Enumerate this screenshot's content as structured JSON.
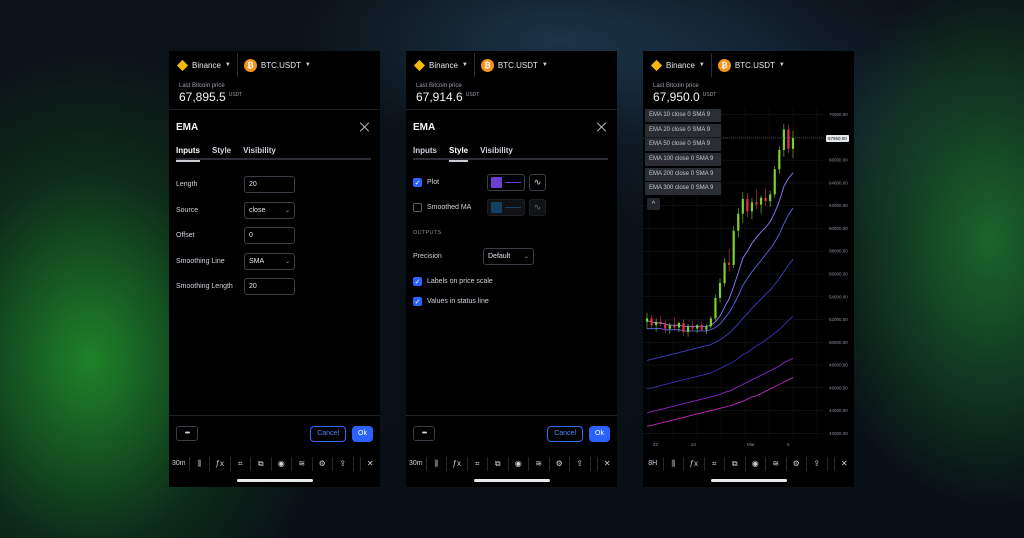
{
  "panels": [
    {
      "topbar": {
        "exchange": "Binance",
        "symbol": "BTC.USDT"
      },
      "price": {
        "label": "Last Bitcoin price",
        "value": "67,895.5",
        "unit": "USDT"
      },
      "dialog": {
        "title": "EMA",
        "tabs": [
          "Inputs",
          "Style",
          "Visibility"
        ],
        "active_tab": "Inputs",
        "inputs": [
          {
            "label": "Length",
            "value": "20"
          },
          {
            "label": "Source",
            "value": "close",
            "dropdown": true
          },
          {
            "label": "Offset",
            "value": "0"
          },
          {
            "label": "Smoothing Line",
            "value": "SMA",
            "dropdown": true
          },
          {
            "label": "Smoothing Length",
            "value": "20"
          }
        ],
        "more_label": "•••",
        "cancel_label": "Cancel",
        "ok_label": "Ok"
      },
      "toolbar": {
        "interval": "30m"
      }
    },
    {
      "topbar": {
        "exchange": "Binance",
        "symbol": "BTC.USDT"
      },
      "price": {
        "label": "Last Bitcoin price",
        "value": "67,914.6",
        "unit": "USDT"
      },
      "dialog": {
        "title": "EMA",
        "tabs": [
          "Inputs",
          "Style",
          "Visibility"
        ],
        "active_tab": "Style",
        "plot": {
          "label": "Plot",
          "checked": true,
          "color": "#6a3fd0"
        },
        "smoothed": {
          "label": "Smoothed MA",
          "checked": false,
          "color": "#2f7fc1"
        },
        "outputs_title": "OUTPUTS",
        "precision": {
          "label": "Precision",
          "value": "Default"
        },
        "labels_on_scale": {
          "label": "Labels on price scale",
          "checked": true
        },
        "values_in_status": {
          "label": "Values in status line",
          "checked": true
        },
        "more_label": "•••",
        "cancel_label": "Cancel",
        "ok_label": "Ok"
      },
      "toolbar": {
        "interval": "30m"
      }
    },
    {
      "topbar": {
        "exchange": "Binance",
        "symbol": "BTC.USDT"
      },
      "price": {
        "label": "Last Bitcoin price",
        "value": "67,950.0",
        "unit": "USDT"
      },
      "legend": [
        "EMA 10 close 0 SMA 9",
        "EMA 20 close 0 SMA 9",
        "EMA 50 close 0 SMA 9",
        "EMA 100 close 0 SMA 9",
        "EMA 200 close 0 SMA 9",
        "EMA 300 close 0 SMA 9"
      ],
      "collapse_icon": "^",
      "last_price_tag": "67950.00",
      "toolbar": {
        "interval": "8H"
      }
    }
  ],
  "toolbar_icons": [
    "candles-icon",
    "fx-icon",
    "crosshair-icon",
    "compare-icon",
    "eye-icon",
    "layers-icon",
    "gear-icon",
    "share-icon",
    "close-icon"
  ],
  "colors": {
    "accent": "#2962ff",
    "binance": "#f0b90b",
    "bitcoin": "#f7931a",
    "up": "#7bd12f",
    "down": "#e0324b"
  },
  "chart_data": {
    "type": "line",
    "title": "",
    "y_ticks": [
      "70000.00",
      "68000.00",
      "66000.00",
      "64000.00",
      "62000.00",
      "60000.00",
      "58000.00",
      "56000.00",
      "54000.00",
      "52000.00",
      "50000.00",
      "48000.00",
      "46000.00",
      "44000.00",
      "42000.00"
    ],
    "x_ticks": [
      "22",
      "24",
      "Mar",
      "5"
    ],
    "ylim": [
      41500,
      70500
    ],
    "candles": [
      [
        51800,
        52600,
        51200,
        52100
      ],
      [
        52100,
        52400,
        51300,
        51500
      ],
      [
        51500,
        52100,
        50900,
        51800
      ],
      [
        51800,
        52300,
        51400,
        51600
      ],
      [
        51600,
        51900,
        50800,
        51200
      ],
      [
        51200,
        51700,
        50700,
        51500
      ],
      [
        51500,
        52200,
        51100,
        51300
      ],
      [
        51300,
        51800,
        50900,
        51700
      ],
      [
        51700,
        52000,
        50600,
        50900
      ],
      [
        50900,
        51600,
        50500,
        51400
      ],
      [
        51400,
        51900,
        51000,
        51200
      ],
      [
        51200,
        51600,
        50800,
        51500
      ],
      [
        51500,
        51800,
        51000,
        51100
      ],
      [
        51100,
        51600,
        50700,
        51400
      ],
      [
        51400,
        52300,
        51200,
        52100
      ],
      [
        52100,
        54200,
        51900,
        53900
      ],
      [
        53900,
        55600,
        53500,
        55200
      ],
      [
        55200,
        57400,
        54900,
        57000
      ],
      [
        57000,
        58200,
        56200,
        56800
      ],
      [
        56800,
        60200,
        56500,
        59800
      ],
      [
        59800,
        61800,
        59200,
        61300
      ],
      [
        61300,
        63200,
        60500,
        62600
      ],
      [
        62600,
        63100,
        61000,
        61500
      ],
      [
        61500,
        62700,
        60800,
        62300
      ],
      [
        62300,
        63400,
        61700,
        62100
      ],
      [
        62100,
        62900,
        61300,
        62700
      ],
      [
        62700,
        63500,
        62000,
        62400
      ],
      [
        62400,
        63300,
        61900,
        63000
      ],
      [
        63000,
        65500,
        62700,
        65200
      ],
      [
        65200,
        67200,
        64800,
        66900
      ],
      [
        66900,
        69200,
        66300,
        68700
      ],
      [
        68700,
        69100,
        66600,
        67000
      ],
      [
        67000,
        68600,
        66200,
        67950
      ]
    ],
    "series": [
      {
        "name": "EMA 10",
        "color": "#8f7dff",
        "values": [
          51900,
          51800,
          51700,
          51700,
          51600,
          51500,
          51500,
          51500,
          51400,
          51400,
          51400,
          51400,
          51400,
          51400,
          51500,
          51800,
          52300,
          53100,
          53800,
          54900,
          56100,
          57400,
          58000,
          58700,
          59200,
          59700,
          60100,
          60600,
          61400,
          62400,
          63700,
          64400,
          64900
        ]
      },
      {
        "name": "EMA 20",
        "color": "#5f63e8",
        "values": [
          51200,
          51200,
          51200,
          51200,
          51100,
          51100,
          51100,
          51100,
          51000,
          51000,
          51000,
          51000,
          51000,
          51000,
          51100,
          51300,
          51600,
          52100,
          52600,
          53300,
          54100,
          55000,
          55600,
          56200,
          56700,
          57200,
          57700,
          58200,
          58800,
          59500,
          60400,
          61200,
          61800
        ]
      },
      {
        "name": "EMA 50",
        "color": "#3d3fc4",
        "values": [
          48400,
          48500,
          48600,
          48700,
          48800,
          48900,
          49000,
          49100,
          49200,
          49300,
          49400,
          49500,
          49600,
          49700,
          49800,
          50000,
          50200,
          50500,
          50800,
          51200,
          51600,
          52100,
          52500,
          53000,
          53400,
          53800,
          54200,
          54600,
          55100,
          55600,
          56200,
          56800,
          57300
        ]
      },
      {
        "name": "EMA 100",
        "color": "#3a2fb0",
        "values": [
          45900,
          46000,
          46100,
          46200,
          46300,
          46400,
          46500,
          46600,
          46700,
          46800,
          46900,
          47000,
          47100,
          47200,
          47300,
          47500,
          47700,
          47900,
          48100,
          48300,
          48600,
          48900,
          49100,
          49400,
          49700,
          49900,
          50200,
          50500,
          50800,
          51100,
          51500,
          51900,
          52300
        ]
      },
      {
        "name": "EMA 200",
        "color": "#8a2ac8",
        "values": [
          43800,
          43900,
          44000,
          44100,
          44200,
          44300,
          44400,
          44500,
          44600,
          44700,
          44800,
          44900,
          45000,
          45100,
          45200,
          45300,
          45400,
          45600,
          45700,
          45900,
          46100,
          46300,
          46500,
          46700,
          46900,
          47100,
          47300,
          47500,
          47700,
          47900,
          48200,
          48400,
          48600
        ]
      },
      {
        "name": "EMA 300",
        "color": "#c02ac2",
        "values": [
          42600,
          42700,
          42800,
          42900,
          43000,
          43100,
          43200,
          43300,
          43400,
          43500,
          43600,
          43700,
          43800,
          43900,
          44000,
          44100,
          44200,
          44300,
          44400,
          44500,
          44700,
          44800,
          45000,
          45200,
          45300,
          45500,
          45700,
          45900,
          46100,
          46300,
          46500,
          46700,
          46900
        ]
      }
    ],
    "grid": true
  }
}
